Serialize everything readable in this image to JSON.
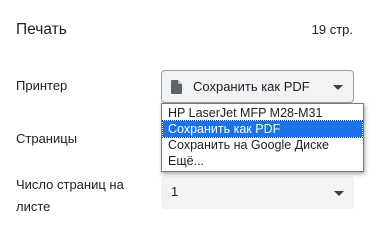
{
  "header": {
    "title": "Печать",
    "page_count": "19 стр."
  },
  "printer": {
    "label": "Принтер",
    "selected": "Сохранить как PDF",
    "icon": "document-icon",
    "options": [
      "HP LaserJet MFP M28-M31",
      "Сохранить как PDF",
      "Сохранить на Google Диске",
      "Ещё..."
    ],
    "highlighted_option": "Сохранить как PDF"
  },
  "pages": {
    "label": "Страницы"
  },
  "pages_per_sheet": {
    "label": "Число страниц на листе",
    "value": "1"
  },
  "colors": {
    "select_bg": "#f1f3f4",
    "highlight": "#1a73e8"
  }
}
